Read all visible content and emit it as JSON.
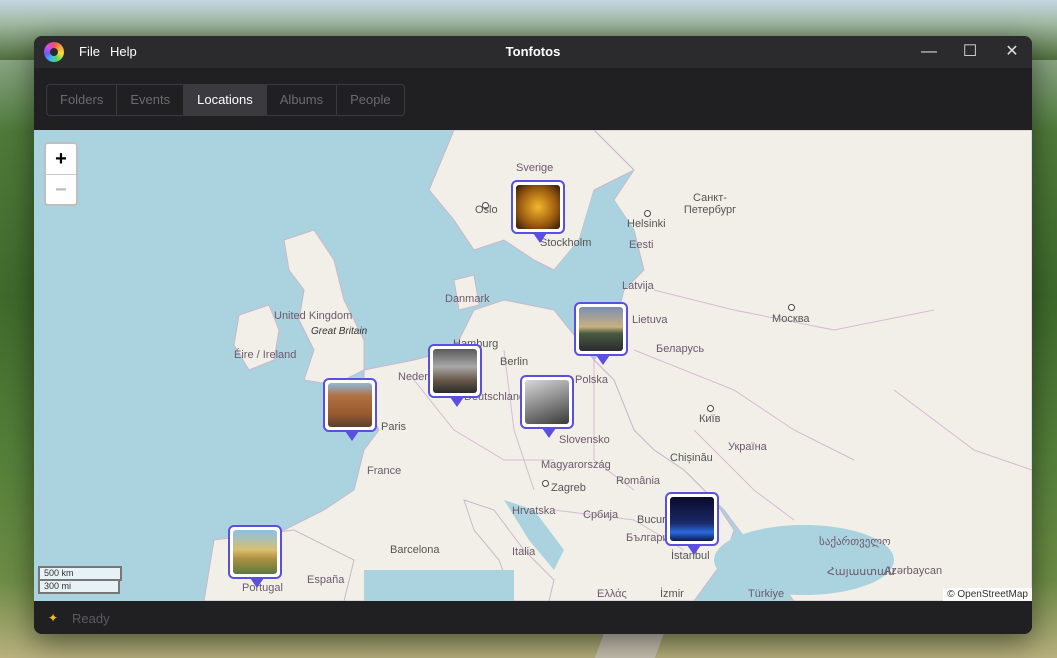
{
  "window": {
    "title": "Tonfotos"
  },
  "menu": {
    "file": "File",
    "help": "Help"
  },
  "controls": {
    "minimize": "—",
    "maximize": "☐",
    "close": "✕"
  },
  "tabs": [
    {
      "label": "Folders",
      "active": false
    },
    {
      "label": "Events",
      "active": false
    },
    {
      "label": "Locations",
      "active": true
    },
    {
      "label": "Albums",
      "active": false
    },
    {
      "label": "People",
      "active": false
    }
  ],
  "map": {
    "zoom_in": "+",
    "zoom_out": "−",
    "scale_km": "500 km",
    "scale_mi": "300 mi",
    "attribution": "© OpenStreetMap",
    "labels": {
      "sverige": "Sverige",
      "oslo": "Oslo",
      "stockholm": "Stockholm",
      "helsinki": "Helsinki",
      "spb": "Санкт-\nПетербург",
      "eesti": "Eesti",
      "latvija": "Latvija",
      "lietuva": "Lietuva",
      "danmark": "Danmark",
      "uk": "United Kingdom",
      "gb": "Great Britain",
      "eire": "Éire / Ireland",
      "hamburg": "Hamburg",
      "berlin": "Berlin",
      "nederland": "Nederland",
      "deutschland": "Deutschland",
      "polska": "Polska",
      "belarus": "Беларусь",
      "moskva": "Москва",
      "paris": "Paris",
      "france": "France",
      "slovensko": "Slovensko",
      "kyiv": "Київ",
      "ukraina": "Україна",
      "magyar": "Magyarország",
      "chisinau": "Chișinău",
      "zagreb": "Zagreb",
      "romania": "România",
      "hrvatska": "Hrvatska",
      "srbija": "Србија",
      "bucuresti": "București",
      "bulgaria": "България",
      "barcelona": "Barcelona",
      "italia": "Italia",
      "istanbul": "İstanbul",
      "sakartvelo": "საქართველო",
      "hayastan": "Հայաստան",
      "azerbaycan": "Azərbaycan",
      "espana": "España",
      "portugal": "Portugal",
      "ellas": "Ελλάς",
      "izmir": "İzmir",
      "turkiye": "Türkiye"
    }
  },
  "status": {
    "text": "Ready"
  },
  "colors": {
    "accent": "#5a4fe0",
    "sea": "#aad3df",
    "land": "#f2efe9",
    "status_icon": "#f0c020"
  }
}
